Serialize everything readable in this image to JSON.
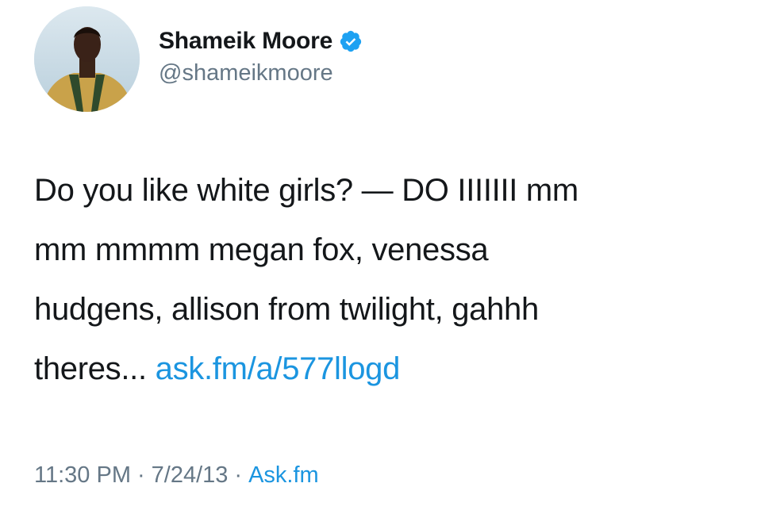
{
  "user": {
    "display_name": "Shameik Moore",
    "handle": "@shameikmoore",
    "verified": true,
    "verified_icon": "verified-badge-icon"
  },
  "tweet": {
    "lines": [
      "Do you like white girls? — DO IIIIIII mm",
      "mm mmmm megan fox, venessa",
      "hudgens, allison from twilight, gahhh",
      "theres... "
    ],
    "link_text": "ask.fm/a/577llogd",
    "time": "11:30 PM",
    "separator": "·",
    "date": "7/24/13",
    "source": "Ask.fm"
  },
  "colors": {
    "link": "#1b95e0",
    "muted": "#657786",
    "text": "#14171a",
    "verified": "#1da1f2"
  }
}
